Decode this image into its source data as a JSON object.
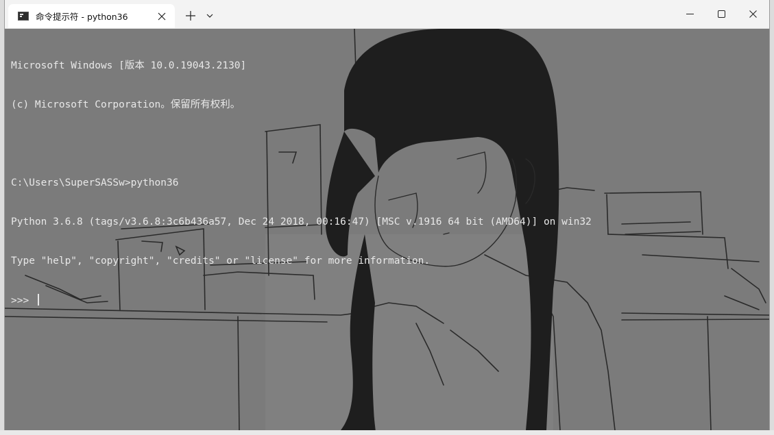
{
  "tab": {
    "title": "命令提示符 - python36",
    "icon": "cmd-icon"
  },
  "titlebar_icons": {
    "close_tab": "close-icon",
    "new_tab": "plus-icon",
    "dropdown": "chevron-down-icon",
    "minimize": "minimize-icon",
    "maximize": "maximize-icon",
    "close_window": "close-icon"
  },
  "terminal": {
    "lines": [
      "Microsoft Windows [版本 10.0.19043.2130]",
      "(c) Microsoft Corporation。保留所有权利。",
      "",
      "C:\\Users\\SuperSASSw>python36",
      "Python 3.6.8 (tags/v3.6.8:3c6b436a57, Dec 24 2018, 00:16:47) [MSC v.1916 64 bit (AMD64)] on win32",
      "Type \"help\", \"copyright\", \"credits\" or \"license\" for more information.",
      ">>> "
    ]
  },
  "colors": {
    "terminal_bg": "#7a7a7a",
    "terminal_text": "#e8e8e8",
    "titlebar_bg": "#f3f3f3"
  }
}
